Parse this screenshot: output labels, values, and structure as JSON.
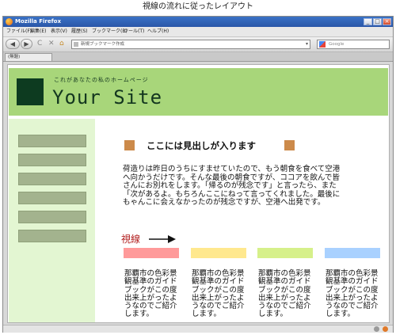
{
  "caption": "視線の流れに従ったレイアウト",
  "window": {
    "title": "Mozilla Firefox",
    "buttons": {
      "minimize": "_",
      "maximize": "□",
      "close": "×"
    }
  },
  "menu": [
    "ファイル(F)",
    "編集(E)",
    "表示(V)",
    "履歴(S)",
    "ブックマーク(B)",
    "ツール(T)",
    "ヘルプ(H)"
  ],
  "nav": {
    "back_glyph": "◀",
    "forward_glyph": "▶",
    "reload_glyph": "C",
    "stop_glyph": "✕",
    "home_glyph": "⌂",
    "url": "新規ブックマーク作成",
    "search_placeholder": "Google"
  },
  "tab": {
    "label": "(無題)"
  },
  "site": {
    "tagline": "これがあなたの私のホームページ",
    "name": "Your Site"
  },
  "sidebar": {
    "item_count": 6
  },
  "main": {
    "heading": "ここには見出しが入ります",
    "body": "荷造りは昨日のうちにすませていたので、もう朝食を食べて空港へ向かうだけです。そんな最後の朝食ですが、ココアを飲んで皆さんにお別れをします。「帰るのが残念です」と言ったら、また「次があるよ。もちろんここにねって言ってくれました。最後にもゃんこに会えなかったのが残念ですが、空港へ出発です。",
    "sightline_label": "視線"
  },
  "columns": [
    {
      "color": "#ff9a9a",
      "text": "那覇市の色彩景観基準のガイドブックがこの度出来上がったようなのでご紹介します。"
    },
    {
      "color": "#ffe88e",
      "text": "那覇市の色彩景観基準のガイドブックがこの度出来上がったようなのでご紹介します。"
    },
    {
      "color": "#d6f08a",
      "text": "那覇市の色彩景観基準のガイドブックがこの度出来上がったようなのでご紹介します。"
    },
    {
      "color": "#a9d1ff",
      "text": "那覇市の色彩景観基準のガイドブックがこの度出来上がったようなのでご紹介します。"
    }
  ],
  "colors": {
    "header": "#a8d67a",
    "logo": "#0d3b20",
    "sidebar": "#e3f6d2",
    "sidebar_item": "#a3b38e",
    "heading_deco": "#cc8a4a",
    "sightline": "#b21f1f"
  }
}
